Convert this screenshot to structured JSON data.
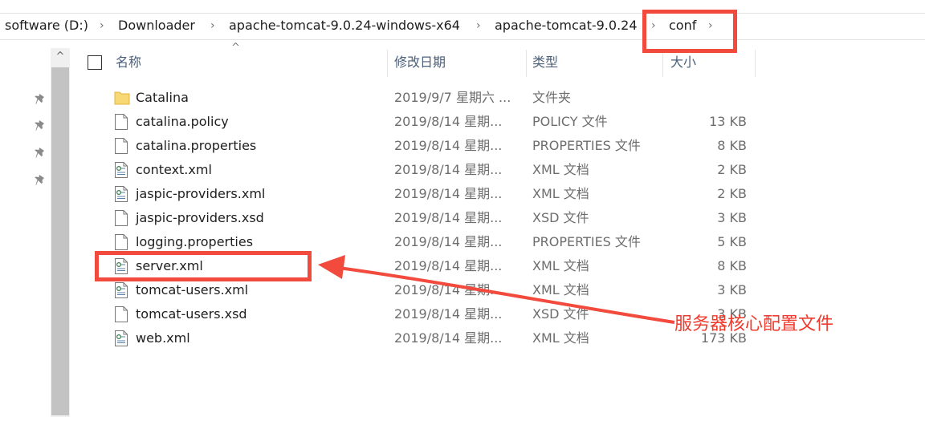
{
  "breadcrumb": {
    "items": [
      {
        "label": "software (D:)"
      },
      {
        "label": "Downloader"
      },
      {
        "label": "apache-tomcat-9.0.24-windows-x64"
      },
      {
        "label": "apache-tomcat-9.0.24"
      },
      {
        "label": "conf"
      }
    ],
    "separator_icon": "chevron-right-icon"
  },
  "columns": {
    "name": "名称",
    "date": "修改日期",
    "type": "类型",
    "size": "大小"
  },
  "files": [
    {
      "name": "Catalina",
      "date": "2019/9/7 星期六 ...",
      "type": "文件夹",
      "size": "",
      "icon": "folder-icon"
    },
    {
      "name": "catalina.policy",
      "date": "2019/8/14 星期...",
      "type": "POLICY 文件",
      "size": "13 KB",
      "icon": "file-icon"
    },
    {
      "name": "catalina.properties",
      "date": "2019/8/14 星期...",
      "type": "PROPERTIES 文件",
      "size": "8 KB",
      "icon": "file-icon"
    },
    {
      "name": "context.xml",
      "date": "2019/8/14 星期...",
      "type": "XML 文档",
      "size": "2 KB",
      "icon": "xml-file-icon"
    },
    {
      "name": "jaspic-providers.xml",
      "date": "2019/8/14 星期...",
      "type": "XML 文档",
      "size": "2 KB",
      "icon": "xml-file-icon"
    },
    {
      "name": "jaspic-providers.xsd",
      "date": "2019/8/14 星期...",
      "type": "XSD 文件",
      "size": "3 KB",
      "icon": "file-icon"
    },
    {
      "name": "logging.properties",
      "date": "2019/8/14 星期...",
      "type": "PROPERTIES 文件",
      "size": "5 KB",
      "icon": "file-icon"
    },
    {
      "name": "server.xml",
      "date": "2019/8/14 星期...",
      "type": "XML 文档",
      "size": "8 KB",
      "icon": "xml-file-icon"
    },
    {
      "name": "tomcat-users.xml",
      "date": "2019/8/14 星期...",
      "type": "XML 文档",
      "size": "3 KB",
      "icon": "xml-file-icon"
    },
    {
      "name": "tomcat-users.xsd",
      "date": "2019/8/14 星期...",
      "type": "XSD 文件",
      "size": "3 KB",
      "icon": "file-icon"
    },
    {
      "name": "web.xml",
      "date": "2019/8/14 星期...",
      "type": "XML 文档",
      "size": "173 KB",
      "icon": "xml-file-icon"
    }
  ],
  "annotation": {
    "note": "服务器核心配置文件",
    "color": "#f24a3c"
  },
  "nav": {
    "pin_icon": "pin-icon",
    "scroll_up_icon": "chevron-up-icon"
  }
}
